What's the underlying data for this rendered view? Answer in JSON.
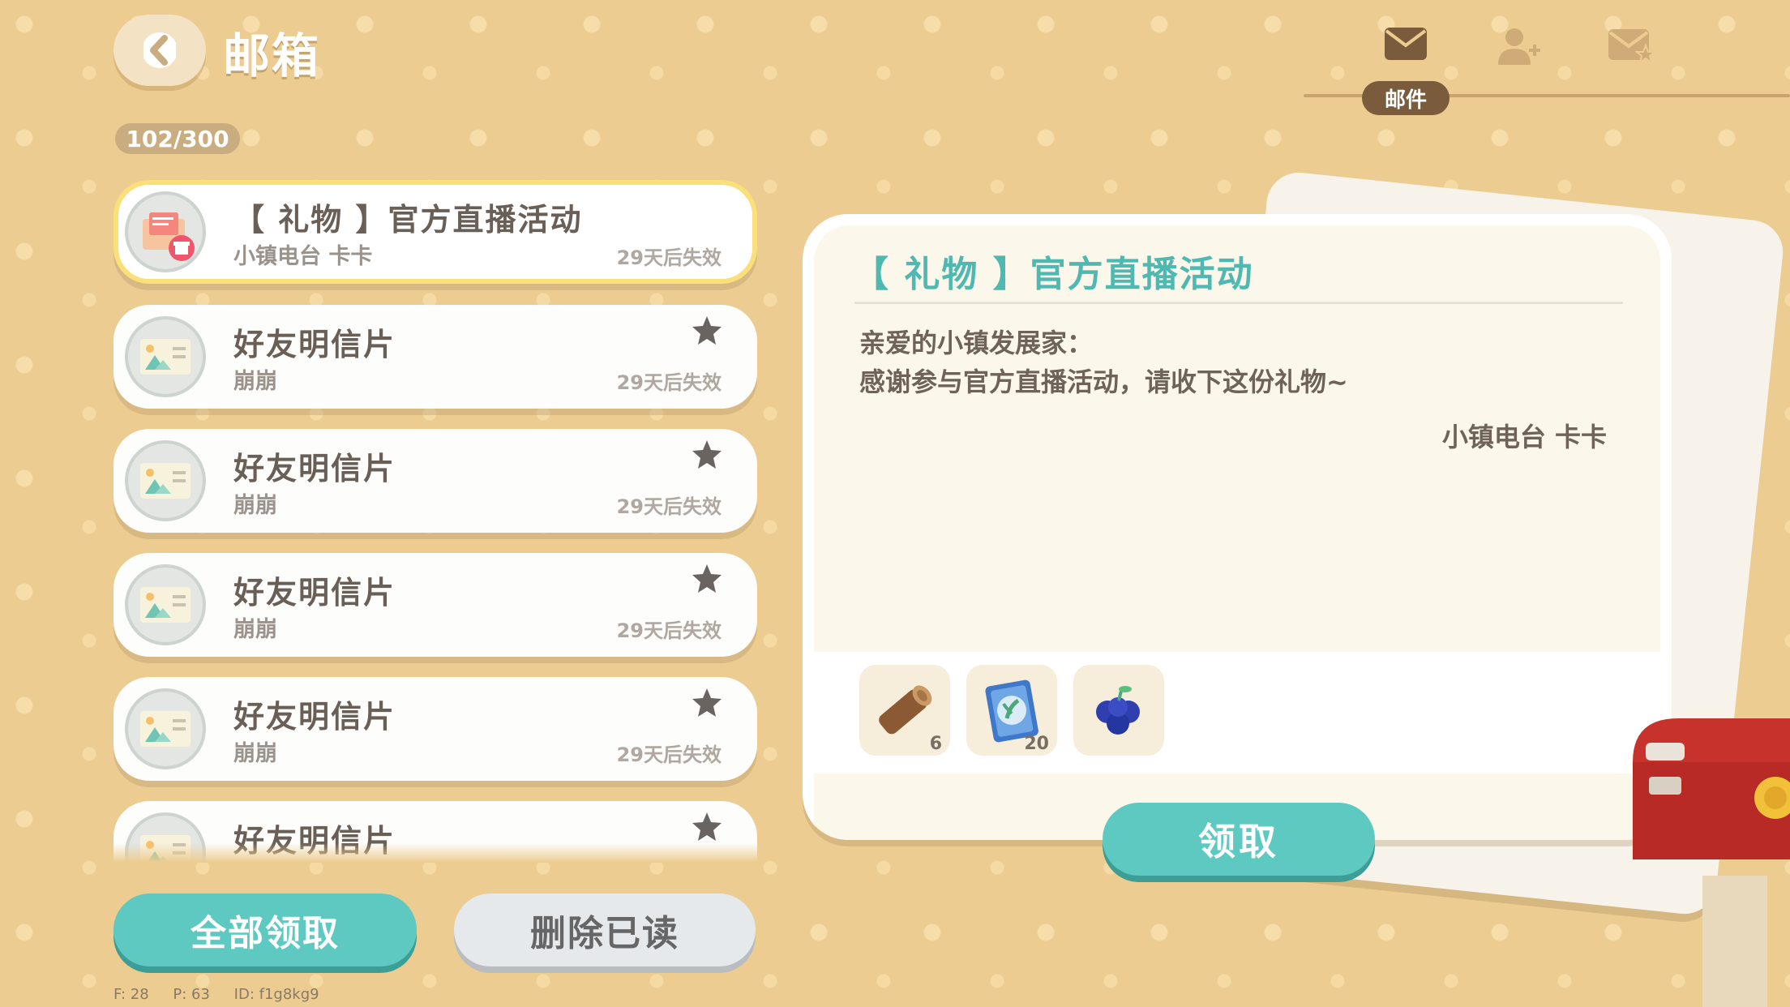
{
  "header": {
    "back_icon": "chevron-left-icon",
    "title": "邮箱",
    "mail_count": "102/300"
  },
  "tabs": [
    {
      "icon": "envelope-icon",
      "label": "邮件",
      "active": true
    },
    {
      "icon": "add-friend-icon",
      "active": false
    },
    {
      "icon": "starred-mail-icon",
      "active": false
    }
  ],
  "mail_list": [
    {
      "title": "【 礼物 】官方直播活动",
      "sender": "小镇电台 卡卡",
      "expiry": "29天后失效",
      "icon": "gift-letter-icon",
      "selected": true,
      "starred": false
    },
    {
      "title": "好友明信片",
      "sender": "崩崩",
      "expiry": "29天后失效",
      "icon": "postcard-icon",
      "selected": false,
      "starred": true
    },
    {
      "title": "好友明信片",
      "sender": "崩崩",
      "expiry": "29天后失效",
      "icon": "postcard-icon",
      "selected": false,
      "starred": true
    },
    {
      "title": "好友明信片",
      "sender": "崩崩",
      "expiry": "29天后失效",
      "icon": "postcard-icon",
      "selected": false,
      "starred": true
    },
    {
      "title": "好友明信片",
      "sender": "崩崩",
      "expiry": "29天后失效",
      "icon": "postcard-icon",
      "selected": false,
      "starred": true
    },
    {
      "title": "好友明信片",
      "sender": "",
      "expiry": "",
      "icon": "postcard-icon",
      "selected": false,
      "starred": true
    }
  ],
  "buttons": {
    "claim_all": "全部领取",
    "delete_read": "删除已读",
    "claim": "领取"
  },
  "detail": {
    "title": "【 礼物 】官方直播活动",
    "greeting": "亲爱的小镇发展家：",
    "body": "感谢参与官方直播活动，请收下这份礼物~",
    "signature": "小镇电台 卡卡",
    "rewards": [
      {
        "icon": "wood-log-icon",
        "count": "6"
      },
      {
        "icon": "blueprint-scroll-icon",
        "count": "20"
      },
      {
        "icon": "blueberry-icon",
        "count": ""
      }
    ]
  },
  "debug": {
    "f": "F: 28",
    "p": "P: 63",
    "id": "ID: f1g8kg9"
  },
  "colors": {
    "background": "#eccc90",
    "accent_teal": "#5ec9c1",
    "selected_border": "#fbe07a",
    "title_teal": "#4fb8b0"
  }
}
